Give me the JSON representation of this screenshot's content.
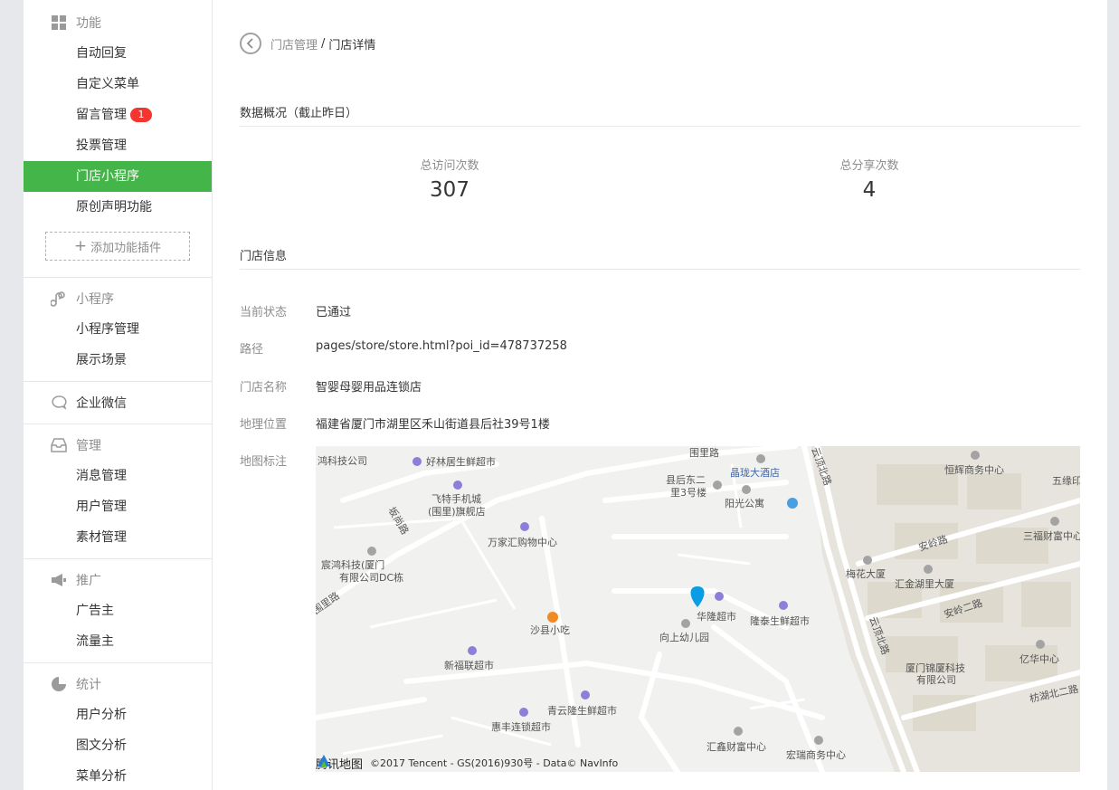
{
  "sidebar": {
    "sections": [
      {
        "title": "功能",
        "icon": "grid-icon",
        "items": [
          {
            "label": "自动回复"
          },
          {
            "label": "自定义菜单"
          },
          {
            "label": "留言管理",
            "badge": "1"
          },
          {
            "label": "投票管理"
          },
          {
            "label": "门店小程序",
            "active": true
          },
          {
            "label": "原创声明功能"
          }
        ],
        "add_button": "添加功能插件"
      },
      {
        "title": "小程序",
        "icon": "link-icon",
        "items": [
          {
            "label": "小程序管理"
          },
          {
            "label": "展示场景"
          }
        ]
      },
      {
        "title": "企业微信",
        "icon": "chat-bubble-icon",
        "items": []
      },
      {
        "title": "管理",
        "icon": "inbox-icon",
        "items": [
          {
            "label": "消息管理"
          },
          {
            "label": "用户管理"
          },
          {
            "label": "素材管理"
          }
        ]
      },
      {
        "title": "推广",
        "icon": "megaphone-icon",
        "items": [
          {
            "label": "广告主"
          },
          {
            "label": "流量主"
          }
        ]
      },
      {
        "title": "统计",
        "icon": "pie-chart-icon",
        "items": [
          {
            "label": "用户分析"
          },
          {
            "label": "图文分析"
          },
          {
            "label": "菜单分析"
          }
        ]
      }
    ]
  },
  "breadcrumb": {
    "parent": "门店管理",
    "separator": "/",
    "current": "门店详情"
  },
  "overview": {
    "title": "数据概况（截止昨日）",
    "stats": [
      {
        "label": "总访问次数",
        "value": "307"
      },
      {
        "label": "总分享次数",
        "value": "4"
      }
    ]
  },
  "store_info": {
    "title": "门店信息",
    "rows": [
      {
        "label": "当前状态",
        "value": "已通过"
      },
      {
        "label": "路径",
        "value": "pages/store/store.html?poi_id=478737258"
      },
      {
        "label": "门店名称",
        "value": "智婴母婴用品连锁店"
      },
      {
        "label": "地理位置",
        "value": "福建省厦门市湖里区禾山街道县后社39号1楼"
      },
      {
        "label": "地图标注",
        "value": ""
      }
    ]
  },
  "map": {
    "logo_text": "腾讯地图",
    "copyright": "©2017 Tencent - GS(2016)930号 - Data© NavInfo",
    "labels": [
      "鸿科技公司",
      "好林居生鲜超市",
      "围里路",
      "晶珑大酒店",
      "云顶北路",
      "恒辉商务中心",
      "五缘印象",
      "飞特手机城",
      "(围里)旗舰店",
      "县后东二",
      "里3号楼",
      "阳光公寓",
      "坂尚路",
      "万家汇购物中心",
      "三福财富中心",
      "安岭路",
      "宸鸿科技(厦门)",
      "有限公司DC栋",
      "梅花大厦",
      "汇金湖里大厦",
      "围里路",
      "华隆超市",
      "隆泰生鲜超市",
      "安岭二路",
      "沙县小吃",
      "向上幼儿园",
      "云顶北路",
      "厦门锦厦科技",
      "有限公司",
      "亿华中心",
      "新福联超市",
      "枋湖北二路",
      "青云隆生鲜超市",
      "惠丰连锁超市",
      "汇鑫财富中心",
      "宏瑞商务中心"
    ],
    "colors": {
      "marker": "#0a9de6",
      "road": "#ffffff",
      "block": "#e6e4dc",
      "base": "#f1f1ef",
      "poi": "#8c7fd9",
      "food": "#f08a24"
    }
  }
}
